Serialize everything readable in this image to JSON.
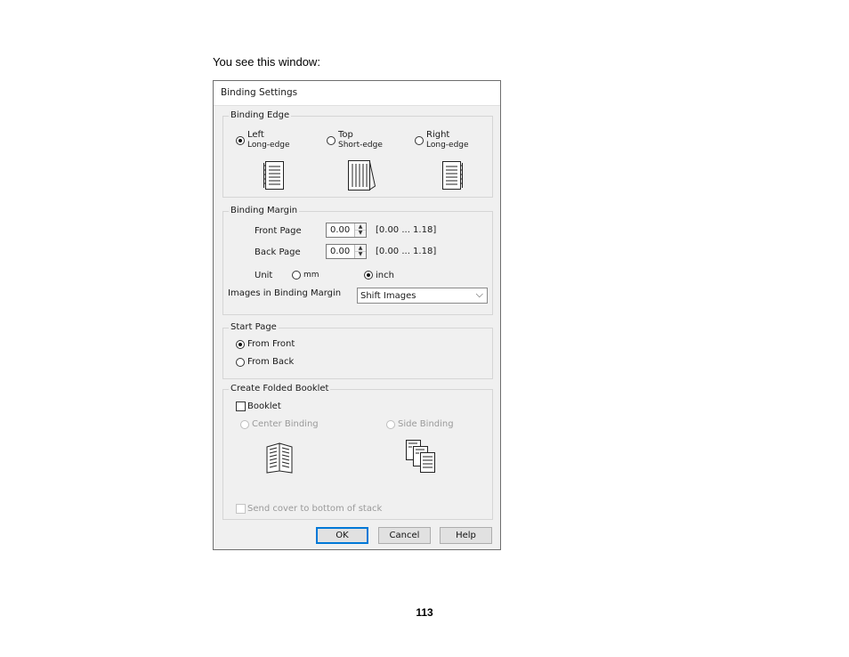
{
  "intro_text": "You see this window:",
  "page_number": "113",
  "dialog": {
    "title": "Binding Settings",
    "binding_edge": {
      "legend": "Binding Edge",
      "options": [
        {
          "line1": "Left",
          "line2": "Long-edge",
          "checked": true
        },
        {
          "line1": "Top",
          "line2": "Short-edge",
          "checked": false
        },
        {
          "line1": "Right",
          "line2": "Long-edge",
          "checked": false
        }
      ],
      "icons": [
        "left-binding-page-icon",
        "top-binding-page-icon",
        "right-binding-page-icon"
      ]
    },
    "binding_margin": {
      "legend": "Binding Margin",
      "front_label": "Front Page",
      "front_value": "0.00",
      "front_range": "[0.00 ... 1.18]",
      "back_label": "Back Page",
      "back_value": "0.00",
      "back_range": "[0.00 ... 1.18]",
      "unit_label": "Unit",
      "unit_mm": "mm",
      "unit_inch": "inch",
      "unit_selected": "inch",
      "images_label": "Images in Binding Margin",
      "images_value": "Shift Images"
    },
    "start_page": {
      "legend": "Start Page",
      "from_front": "From Front",
      "from_back": "From Back",
      "selected": "From Front"
    },
    "folded_booklet": {
      "legend": "Create Folded Booklet",
      "booklet_label": "Booklet",
      "booklet_checked": false,
      "center_binding": "Center Binding",
      "side_binding": "Side Binding",
      "send_cover": "Send cover to bottom of stack"
    },
    "buttons": {
      "ok": "OK",
      "cancel": "Cancel",
      "help": "Help"
    }
  }
}
